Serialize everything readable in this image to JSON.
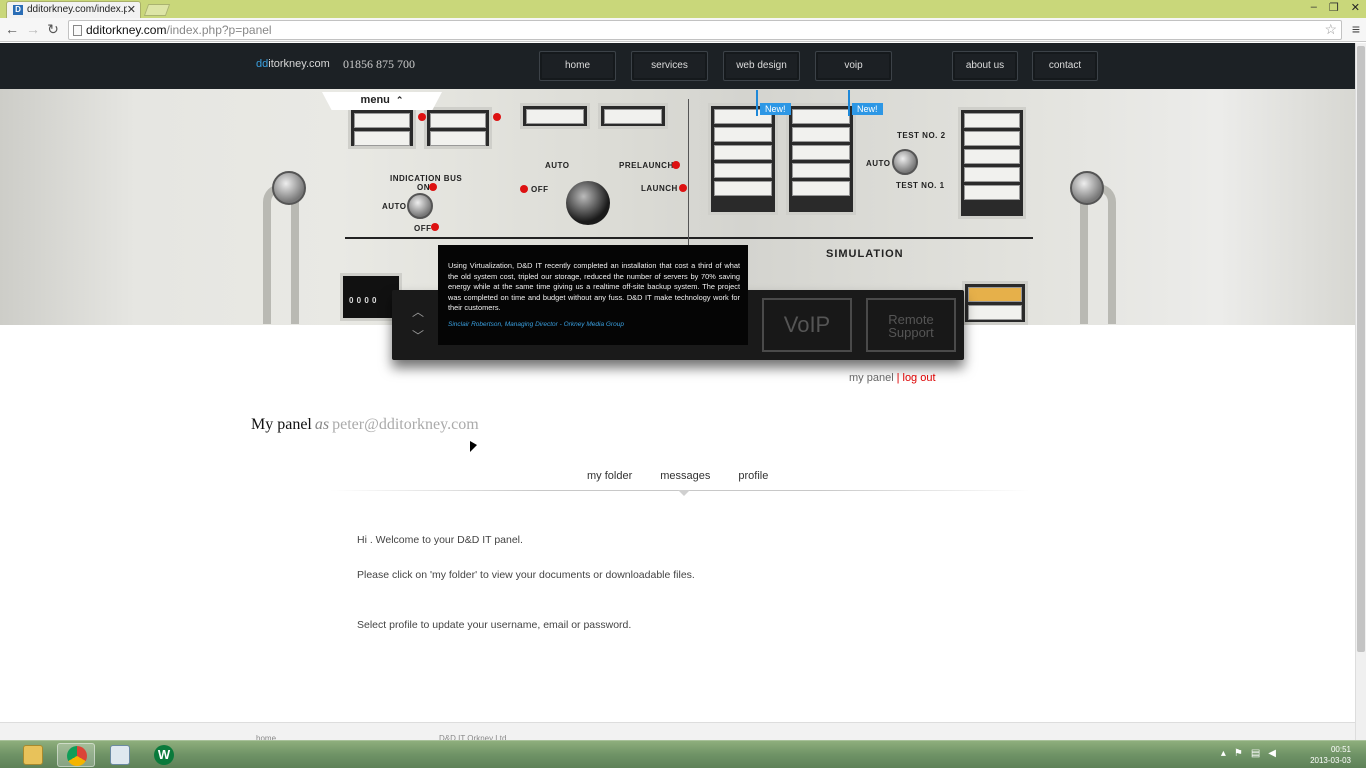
{
  "browser": {
    "tab_title": "dditorkney.com/index.php",
    "url_host": "dditorkney.com",
    "url_path": "/index.php?p=panel",
    "favicon_letter": "D"
  },
  "site": {
    "logo_dd": "dd",
    "logo_rest": "itorkney.com",
    "phone": "01856 875 700",
    "nav": [
      "home",
      "services",
      "web design",
      "voip"
    ],
    "nav_right": [
      "about us",
      "contact"
    ],
    "menu_label": "menu",
    "new_badges": [
      "New!",
      "New!"
    ]
  },
  "hero_labels": {
    "indication_bus": "INDICATION BUS",
    "on": "ON",
    "auto": "AUTO",
    "off": "OFF",
    "auto2": "AUTO",
    "prelaunch": "PRELAUNCH",
    "off2": "OFF",
    "launch": "LAUNCH",
    "test2": "TEST NO. 2",
    "auto3": "AUTO",
    "test1": "TEST NO. 1",
    "simulation": "SIMULATION",
    "counter": "0 0 0 0"
  },
  "testimonial": {
    "text": "Using Virtualization, D&D IT recently completed an installation that cost a third of what the old system cost, tripled our storage, reduced the number of servers by 70% saving energy while at the same time giving us a realtime off-site backup system. The project was completed on time and budget without any fuss. D&D IT make technology work for their customers.",
    "author": "Sinclair Robertson, Managing Director - Orkney Media Group",
    "voip_button": "VoIP",
    "remote_button": "Remote Support"
  },
  "user_links": {
    "my_panel": "my panel",
    "separator": "|",
    "log_out": "log out"
  },
  "panel": {
    "title": "My panel",
    "as_word": "as",
    "email": "peter@dditorkney.com",
    "tabs": [
      "my folder",
      "messages",
      "profile"
    ],
    "active_tab": "messages",
    "messages": [
      "Hi . Welcome to your D&D IT panel.",
      "Please click on 'my folder' to view your documents or downloadable files.",
      "Select profile to update your username, email or password."
    ]
  },
  "footer": {
    "left": "home",
    "center": "D&D IT Orkney Ltd"
  },
  "taskbar": {
    "items": [
      "explorer-icon",
      "chrome-icon",
      "remote-desktop-icon",
      "app-w-icon"
    ],
    "clock_time": "00:51",
    "clock_date": "2013-03-03"
  },
  "colors": {
    "accent_blue": "#3aa0e0",
    "logout_red": "#dd0000",
    "header_bg": "#1c2125"
  }
}
